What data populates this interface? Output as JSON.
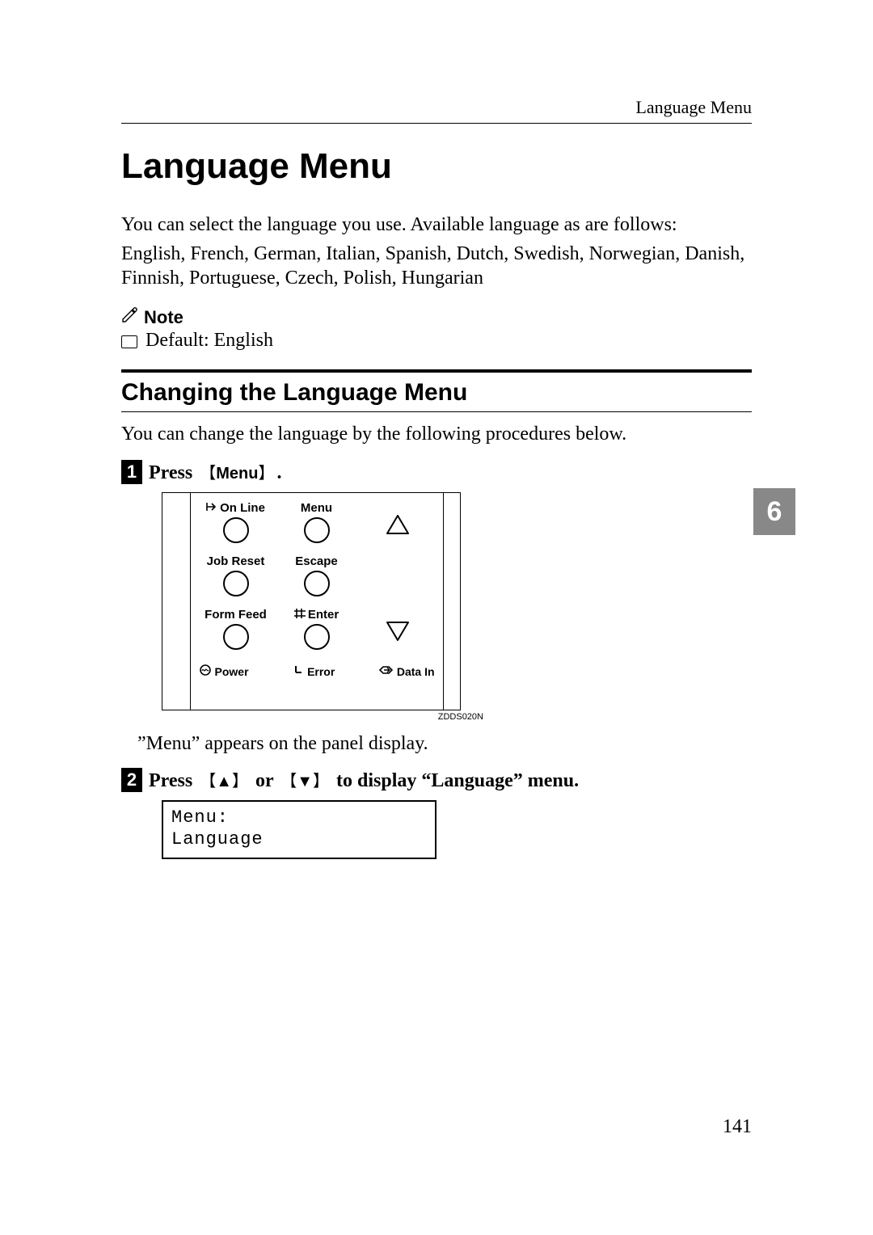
{
  "running_head": "Language Menu",
  "title": "Language Menu",
  "intro_lines": [
    "You can select the language you use. Available language as are follows:",
    "English, French, German, Italian, Spanish, Dutch, Swedish, Norwegian, Danish, Finnish, Portuguese, Czech, Polish, Hungarian"
  ],
  "note": {
    "label": "Note",
    "items": [
      "Default: English"
    ]
  },
  "subsection": {
    "title": "Changing the Language Menu",
    "lead": "You can change the language by the following procedures below."
  },
  "steps": {
    "s1": {
      "num": "1",
      "prefix": "Press ",
      "key": "Menu",
      "suffix": "."
    },
    "s2": {
      "num": "2",
      "prefix": "Press ",
      "mid": " or ",
      "tail": " to display “Language” menu."
    }
  },
  "panel": {
    "labels": {
      "online": "On Line",
      "menu": "Menu",
      "jobreset": "Job Reset",
      "escape": "Escape",
      "formfeed": "Form Feed",
      "enter": "Enter",
      "power": "Power",
      "error": "Error",
      "datain": "Data In"
    },
    "figcode": "ZDDS020N"
  },
  "after_panel": "”Menu” appears on the panel display.",
  "lcd": {
    "line1": "Menu:",
    "line2": " Language"
  },
  "chapter_tab": "6",
  "page_number": "141"
}
